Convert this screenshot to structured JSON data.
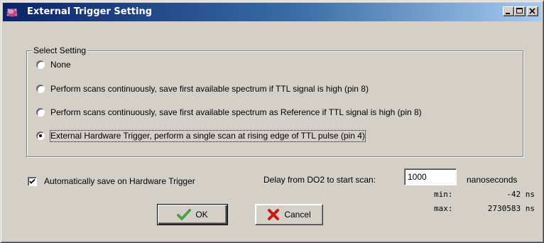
{
  "window": {
    "title": "External Trigger Setting",
    "colors": {
      "titlebar_start": "#0a246a",
      "titlebar_end": "#a6caf0",
      "face": "#d4d0c8"
    },
    "controls": [
      "minimize-icon",
      "maximize-icon",
      "close-icon"
    ]
  },
  "select_setting": {
    "legend": "Select Setting",
    "selected_index": 3,
    "options": [
      {
        "label": "None"
      },
      {
        "label": "Perform scans continuously, save first available spectrum if TTL signal is high (pin 8)"
      },
      {
        "label": "Perform scans continuously, save first available spectrum as Reference if TTL signal is high (pin 8)"
      },
      {
        "label": "External Hardware Trigger, perform a single scan at rising edge of TTL pulse (pin 4)"
      }
    ]
  },
  "auto_save": {
    "label": "Automatically save on Hardware Trigger",
    "checked": true
  },
  "delay": {
    "label": "Delay from DO2 to start scan:",
    "value": "1000",
    "unit": "nanoseconds",
    "min_label": "min:",
    "min_value": "-42 ns",
    "max_label": "max:",
    "max_value": "2730583 ns"
  },
  "buttons": {
    "ok_label": "OK",
    "ok_icon": "checkmark-icon",
    "cancel_label": "Cancel",
    "cancel_icon": "red-x-icon"
  }
}
